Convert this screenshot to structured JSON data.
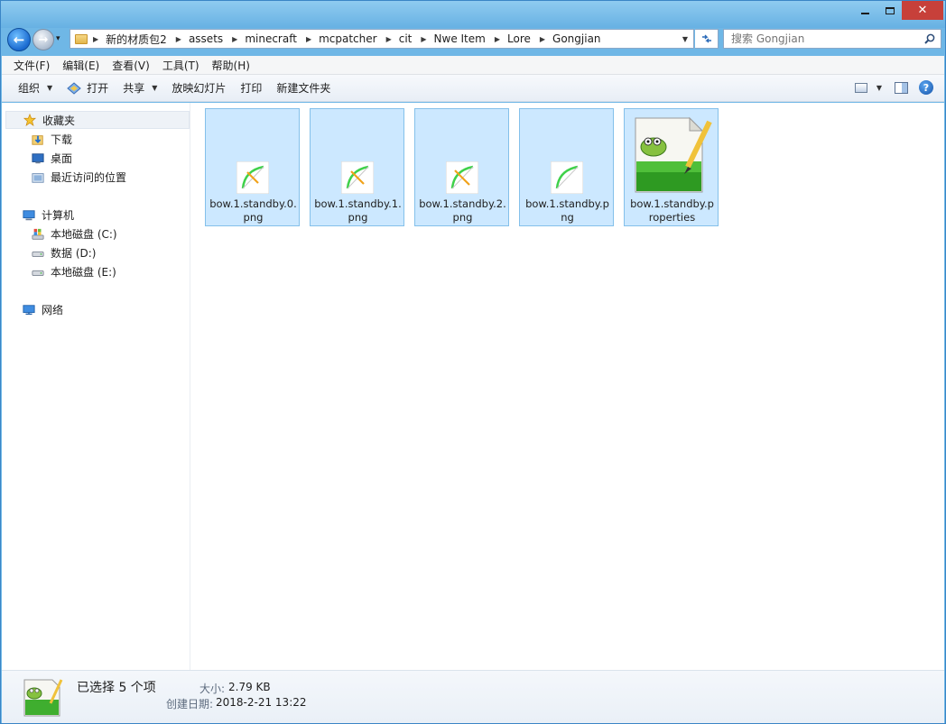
{
  "titlebar": {
    "close_glyph": "✕"
  },
  "nav": {
    "back_glyph": "←",
    "fwd_glyph": "→",
    "history_glyph": "▾",
    "breadcrumbs": [
      "新的材质包2",
      "assets",
      "minecraft",
      "mcpatcher",
      "cit",
      "Nwe Item",
      "Lore",
      "Gongjian"
    ],
    "search_placeholder": "搜索 Gongjian"
  },
  "menu": [
    "文件(F)",
    "编辑(E)",
    "查看(V)",
    "工具(T)",
    "帮助(H)"
  ],
  "toolbar": {
    "organize": "组织",
    "open": "打开",
    "share": "共享",
    "slideshow": "放映幻灯片",
    "print": "打印",
    "new_folder": "新建文件夹",
    "help_glyph": "?"
  },
  "navpane": {
    "favorites": "收藏夹",
    "downloads": "下载",
    "desktop": "桌面",
    "recent": "最近访问的位置",
    "computer": "计算机",
    "drive_c": "本地磁盘 (C:)",
    "drive_d": "数据 (D:)",
    "drive_e": "本地磁盘 (E:)",
    "network": "网络"
  },
  "files": [
    {
      "name": "bow.1.standby.0.png",
      "icon": "bow-image",
      "selected": true
    },
    {
      "name": "bow.1.standby.1.png",
      "icon": "bow-image",
      "selected": true
    },
    {
      "name": "bow.1.standby.2.png",
      "icon": "bow-image",
      "selected": true
    },
    {
      "name": "bow.1.standby.png",
      "icon": "bow-image",
      "selected": true
    },
    {
      "name": "bow.1.standby.properties",
      "icon": "notepad-plus-plus",
      "selected": true
    }
  ],
  "details": {
    "selected_count": "已选择 5 个项",
    "size_label": "大小:",
    "size_value": "2.79 KB",
    "created_label": "创建日期:",
    "created_value": "2018-2-21 13:22"
  },
  "colors": {
    "titlebar": "#6fb7e6",
    "selection_fill": "#cce8ff",
    "selection_border": "#84c0ea",
    "close_button": "#c7403a"
  }
}
